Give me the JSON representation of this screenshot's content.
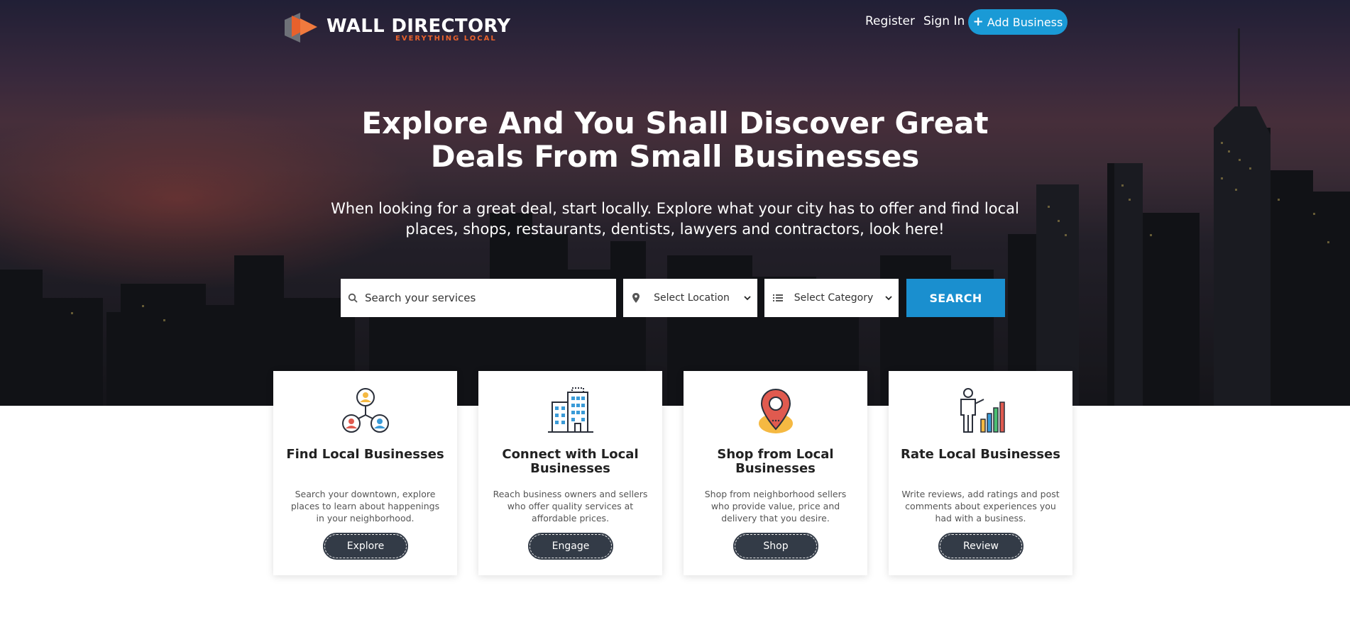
{
  "brand": {
    "name": "WALL DIRECTORY",
    "tagline": "EVERYTHING LOCAL",
    "accent_color": "#e8612c"
  },
  "nav": {
    "register": "Register",
    "sign_in": "Sign In",
    "add_business": "Add Business"
  },
  "hero": {
    "title": "Explore And You Shall Discover Great Deals From Small Businesses",
    "subtitle": "When looking for a great deal, start locally. Explore what your city has to offer and find local places, shops, restaurants, dentists, lawyers and contractors, look here!"
  },
  "search": {
    "placeholder": "Search your services",
    "location_selected": "Select Location",
    "category_selected": "Select Category",
    "button": "SEARCH"
  },
  "cards": [
    {
      "icon": "network-people-icon",
      "title": "Find Local Businesses",
      "description": "Search your downtown, explore places to learn about happenings in your neighborhood.",
      "button": "Explore"
    },
    {
      "icon": "office-building-icon",
      "title": "Connect with Local Businesses",
      "description": "Reach business owners and sellers who offer quality services at affordable prices.",
      "button": "Engage"
    },
    {
      "icon": "map-pin-icon",
      "title": "Shop from Local Businesses",
      "description": "Shop from neighborhood sellers who provide value, price and delivery that you desire.",
      "button": "Shop"
    },
    {
      "icon": "presenter-chart-icon",
      "title": "Rate Local Businesses",
      "description": "Write reviews, add ratings and post comments about experiences you had with a business.",
      "button": "Review"
    }
  ],
  "colors": {
    "primary": "#1a9ad6",
    "button_dark": "#333b47"
  }
}
